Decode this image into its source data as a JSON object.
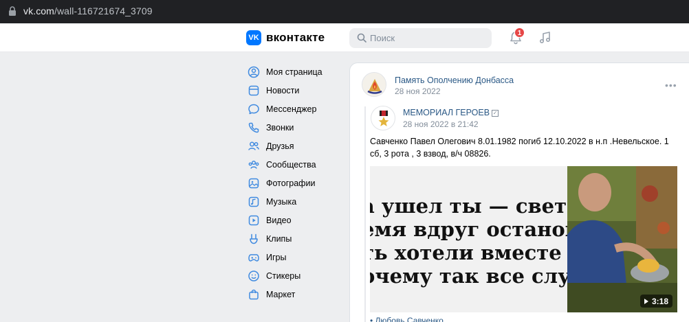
{
  "browser": {
    "url_host": "vk.com",
    "url_path": "/wall-116721674_3709"
  },
  "header": {
    "logo_mark": "VK",
    "logo_text": "вконтакте",
    "search_placeholder": "Поиск",
    "notifications_count": "1"
  },
  "sidebar": {
    "items": [
      {
        "label": "Моя страница",
        "icon": "user-circle-icon"
      },
      {
        "label": "Новости",
        "icon": "newspaper-icon"
      },
      {
        "label": "Мессенджер",
        "icon": "message-icon"
      },
      {
        "label": "Звонки",
        "icon": "phone-icon"
      },
      {
        "label": "Друзья",
        "icon": "friends-icon"
      },
      {
        "label": "Сообщества",
        "icon": "communities-icon"
      },
      {
        "label": "Фотографии",
        "icon": "photo-icon"
      },
      {
        "label": "Музыка",
        "icon": "music-icon"
      },
      {
        "label": "Видео",
        "icon": "video-icon"
      },
      {
        "label": "Клипы",
        "icon": "clips-icon"
      },
      {
        "label": "Игры",
        "icon": "gamepad-icon"
      },
      {
        "label": "Стикеры",
        "icon": "sticker-icon"
      },
      {
        "label": "Маркет",
        "icon": "market-bag-icon"
      }
    ]
  },
  "post": {
    "author": "Память Ополчению Донбасса",
    "date": "28 ноя 2022",
    "repost": {
      "author": "МЕМОРИАЛ ГЕРОЕВ",
      "date": "28 ноя 2022 в 21:42",
      "text": "Савченко Павел Олегович 8.01.1982 погиб 12.10.2022 в н.п .Невельское. 1 сб, 3 рота , 3 взвод, в/ч 08826.",
      "photo_lines": [
        "а ушел ты — свет пом",
        "емя вдруг остановило",
        "ть хотели вместе век",
        "очему так все случил"
      ],
      "video_duration": "3:18",
      "signature": "Любовь Савченко"
    }
  },
  "colors": {
    "brand": "#0077ff",
    "link": "#2a5885",
    "secondary_text": "#818c99",
    "badge": "#e64646",
    "background": "#edeef0"
  }
}
